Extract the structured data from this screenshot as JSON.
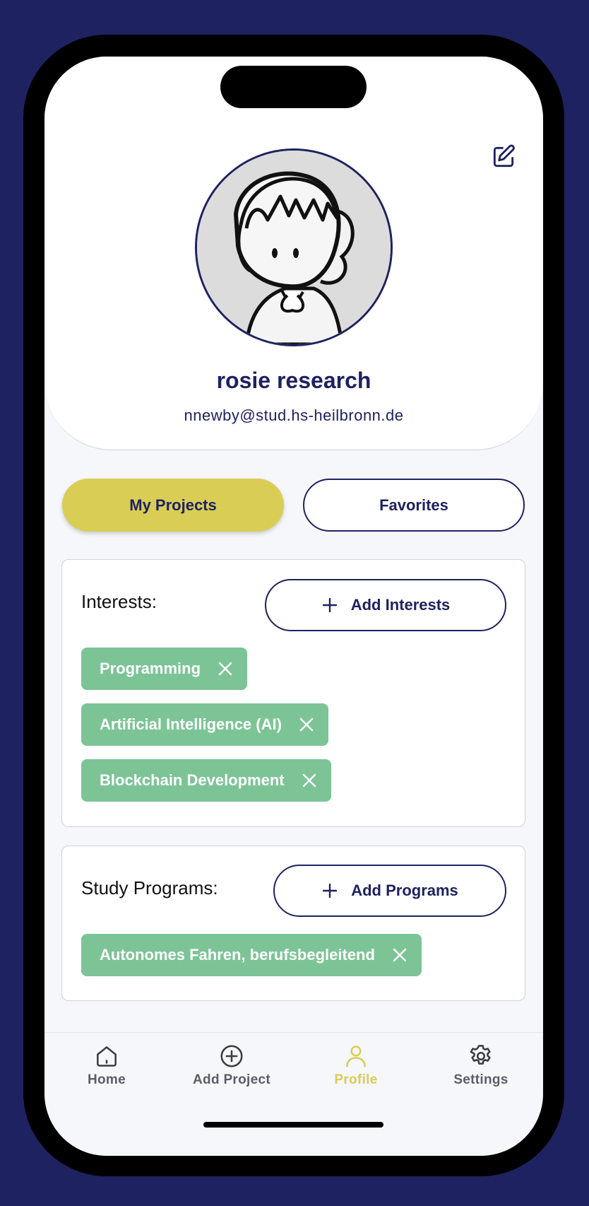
{
  "profile": {
    "name": "rosie research",
    "email": "nnewby@stud.hs-heilbronn.de"
  },
  "tabs": {
    "my_projects": "My Projects",
    "favorites": "Favorites"
  },
  "interests": {
    "title": "Interests:",
    "add_label": "Add Interests",
    "items": [
      "Programming",
      "Artificial Intelligence (AI)",
      "Blockchain Development"
    ]
  },
  "programs": {
    "title": "Study Programs:",
    "add_label": "Add Programs",
    "items": [
      "Autonomes Fahren, berufsbegleitend"
    ]
  },
  "tabbar": {
    "items": [
      {
        "label": "Home",
        "icon": "home-icon"
      },
      {
        "label": "Add Project",
        "icon": "plus-circle-icon"
      },
      {
        "label": "Profile",
        "icon": "person-icon"
      },
      {
        "label": "Settings",
        "icon": "gear-icon"
      }
    ],
    "active": "Profile"
  },
  "colors": {
    "navy": "#1e2260",
    "accent": "#d9cd56",
    "chip": "#7cc496",
    "background": "#f5f7fb"
  }
}
